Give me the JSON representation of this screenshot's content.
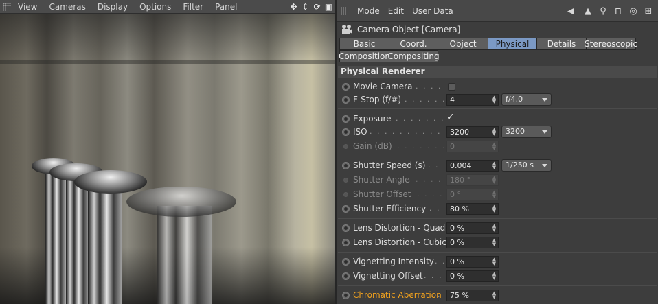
{
  "viewport": {
    "menu": [
      "View",
      "Cameras",
      "Display",
      "Options",
      "Filter",
      "Panel"
    ],
    "nav_icons": [
      "move-icon",
      "zoom-icon",
      "rotate-icon",
      "maximize-icon"
    ]
  },
  "attribute_manager": {
    "menu": [
      "Mode",
      "Edit",
      "User Data"
    ],
    "toolbar_icons": [
      "back-arrow-icon",
      "up-arrow-icon",
      "search-icon",
      "lock-icon",
      "target-icon",
      "new-panel-icon"
    ],
    "object_title": "Camera Object [Camera]",
    "tabs_row1": [
      "Basic",
      "Coord.",
      "Object",
      "Physical",
      "Details",
      "Stereoscopic"
    ],
    "tabs_row2": [
      "Composition",
      "Compositing"
    ],
    "active_tab": "Physical",
    "section_title": "Physical Renderer",
    "params": {
      "movie_camera": {
        "label": "Movie Camera",
        "checked": false
      },
      "fstop": {
        "label": "F-Stop (f/#)",
        "value": "4",
        "preset": "f/4.0"
      },
      "exposure": {
        "label": "Exposure",
        "checked": true
      },
      "iso": {
        "label": "ISO",
        "value": "3200",
        "preset": "3200"
      },
      "gain": {
        "label": "Gain (dB)",
        "value": "0"
      },
      "shutter_speed": {
        "label": "Shutter Speed (s)",
        "value": "0.004",
        "preset": "1/250 s"
      },
      "shutter_angle": {
        "label": "Shutter Angle",
        "value": "180 °"
      },
      "shutter_offset": {
        "label": "Shutter Offset",
        "value": "0 °"
      },
      "shutter_efficiency": {
        "label": "Shutter Efficiency",
        "value": "80 %"
      },
      "lens_quadratic": {
        "label": "Lens Distortion - Quadratic",
        "value": "0 %"
      },
      "lens_cubic": {
        "label": "Lens Distortion - Cubic",
        "value": "0 %"
      },
      "vignetting_intensity": {
        "label": "Vignetting Intensity",
        "value": "0 %"
      },
      "vignetting_offset": {
        "label": "Vignetting Offset",
        "value": "0 %"
      },
      "chromatic_aberration": {
        "label": "Chromatic Aberration",
        "value": "75 %"
      }
    }
  },
  "colors": {
    "active_tab": "#7b99c4",
    "highlight_label": "#f0a11e",
    "panel_bg": "#3d3d3d"
  }
}
